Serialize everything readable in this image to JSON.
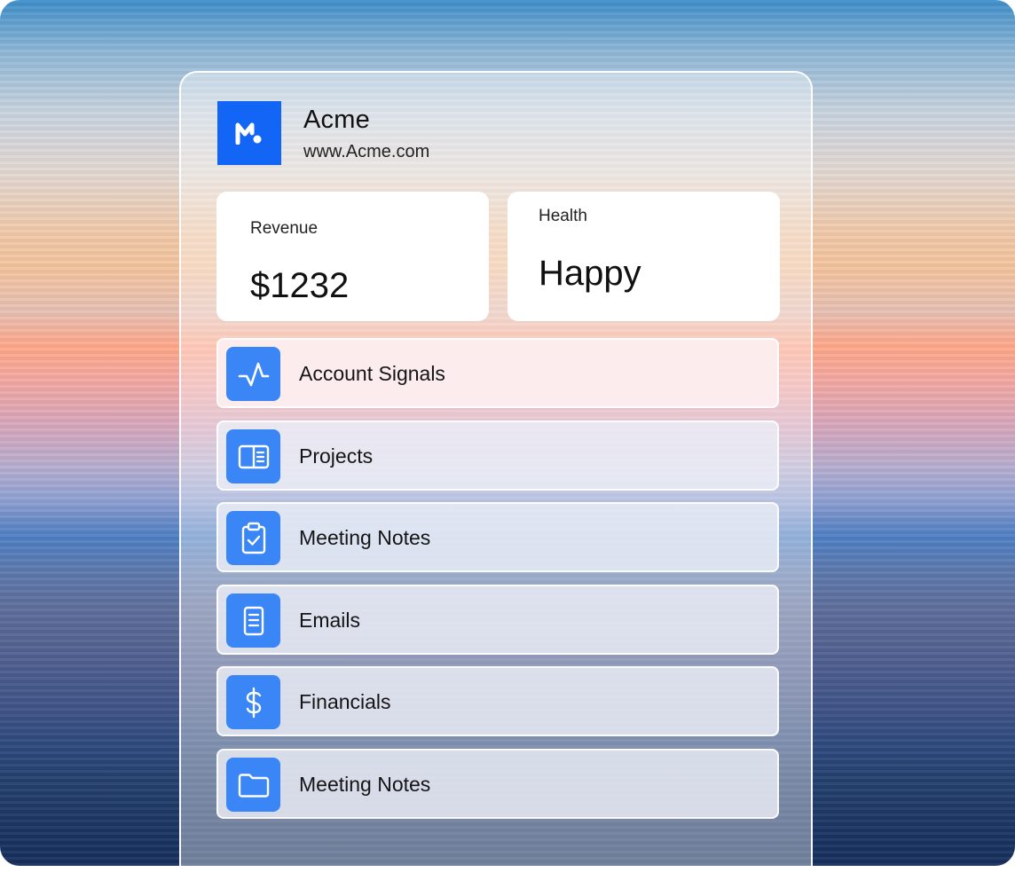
{
  "company": {
    "name": "Acme",
    "url": "www.Acme.com",
    "logo_icon": "acme-m-logo",
    "logo_color": "#1366f5"
  },
  "stats": {
    "revenue": {
      "label": "Revenue",
      "value": "$1232"
    },
    "health": {
      "label": "Health",
      "value": "Happy"
    }
  },
  "nav": {
    "icon_color": "#3b86f7",
    "items": [
      {
        "label": "Account Signals",
        "icon": "pulse-icon"
      },
      {
        "label": "Projects",
        "icon": "book-icon"
      },
      {
        "label": "Meeting Notes",
        "icon": "clipboard-check-icon"
      },
      {
        "label": "Emails",
        "icon": "document-icon"
      },
      {
        "label": "Financials",
        "icon": "dollar-icon"
      },
      {
        "label": "Meeting Notes",
        "icon": "folder-icon"
      }
    ]
  }
}
